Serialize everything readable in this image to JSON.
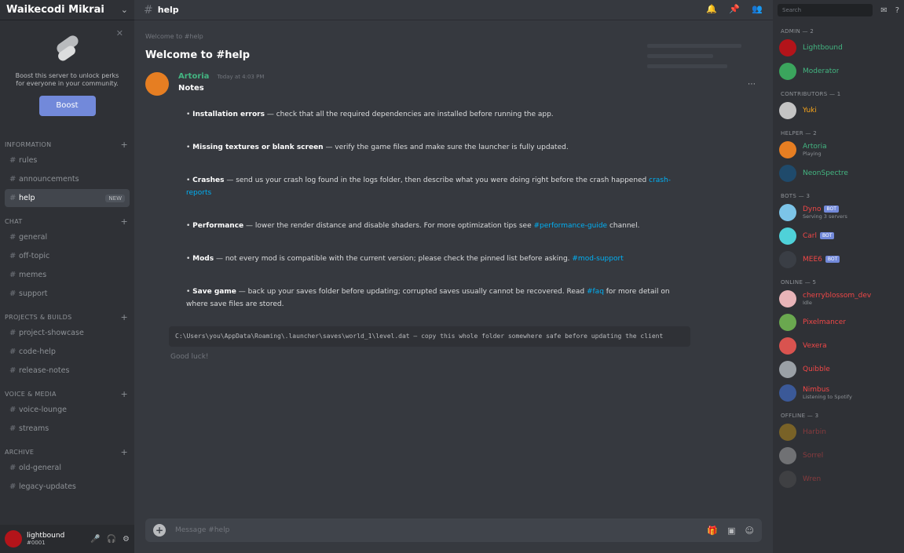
{
  "sidebar": {
    "server_name": "Waikecodi Mikrai",
    "boost": {
      "text": "Boost this server to unlock perks for everyone in your community.",
      "button": "Boost"
    },
    "categories": [
      {
        "label": "Information",
        "channels": [
          "rules",
          "announcements"
        ]
      },
      {
        "label": "Chat",
        "channels": [
          "general",
          "off-topic",
          "memes",
          "support"
        ]
      },
      {
        "label": "Projects & Builds",
        "channels": [
          "project-showcase",
          "code-help",
          "release-notes"
        ]
      },
      {
        "label": "Voice & Media",
        "channels": [
          "voice-lounge",
          "streams"
        ]
      },
      {
        "label": "Archive",
        "channels": [
          "old-general",
          "legacy-updates"
        ]
      }
    ],
    "active_channel": "help",
    "active_badge": "NEW",
    "user": {
      "name": "lightbound",
      "tag": "#0001"
    }
  },
  "main": {
    "channel_name": "help",
    "welcome_small": "Welcome to #help",
    "welcome_title": "Welcome to #help",
    "message": {
      "author": "Artoria",
      "time": "Today at 4:03 PM",
      "heading": "Notes",
      "items": [
        {
          "key": "Installation errors",
          "text": " — check that all the required dependencies are installed before running the app."
        },
        {
          "key": "Missing textures or blank screen",
          "text": " — verify the game files and make sure the launcher is fully updated."
        },
        {
          "key": "Crashes",
          "text": " — send us your crash log found in the logs folder, then describe what you were doing right before the crash happened ",
          "link": "crash-reports"
        },
        {
          "key": "Performance",
          "text": " — lower the render distance and disable shaders. For more optimization tips see ",
          "link": "#performance-guide",
          "tail": " channel."
        },
        {
          "key": "Mods",
          "text": " — not every mod is compatible with the current version; please check the pinned list before asking. ",
          "link": "#mod-support"
        },
        {
          "key": "Save game",
          "text": " — back up your saves folder before updating; corrupted saves usually cannot be recovered. Read ",
          "link": "#faq",
          "tail": " for more detail on where save files are stored."
        }
      ],
      "code": "C:\\Users\\you\\AppData\\Roaming\\.launcher\\saves\\world_1\\level.dat — copy this whole folder somewhere safe before updating the client",
      "after_code": "Good luck!"
    },
    "composer_placeholder": "Message #help"
  },
  "members": {
    "search": "Search",
    "groups": [
      {
        "role": "Admin — 2",
        "people": [
          {
            "name": "Lightbound",
            "color": "#43b581",
            "av": "#b3141a"
          },
          {
            "name": "Moderator",
            "color": "#43b581",
            "av": "#3ba55d"
          }
        ]
      },
      {
        "role": "Contributors — 1",
        "people": [
          {
            "name": "Yuki",
            "color": "#faa61a",
            "av": "#c4c4c4"
          }
        ]
      },
      {
        "role": "Helper — 2",
        "people": [
          {
            "name": "Artoria",
            "sub": "Playing",
            "color": "#43b581",
            "av": "#e67e22"
          },
          {
            "name": "NeonSpectre",
            "color": "#43b581",
            "av": "#1f4a6b"
          }
        ]
      },
      {
        "role": "Bots — 3",
        "people": [
          {
            "name": "Dyno",
            "sub": "Serving 3 servers",
            "bot": "BOT",
            "color": "#f04747",
            "av": "#7cc4e8"
          },
          {
            "name": "Carl",
            "bot": "BOT",
            "color": "#f04747",
            "av": "#4fd1d9"
          },
          {
            "name": "MEE6",
            "bot": "BOT",
            "color": "#f04747",
            "av": "#3a3e45"
          }
        ]
      },
      {
        "role": "Online — 5",
        "people": [
          {
            "name": "cherryblossom_dev",
            "sub": "Idle",
            "color": "#f04747",
            "av": "#e8b4b8"
          },
          {
            "name": "Pixelmancer",
            "color": "#f04747",
            "av": "#6aa84f"
          },
          {
            "name": "Vexera",
            "color": "#f04747",
            "av": "#d9534f"
          },
          {
            "name": "Quibble",
            "color": "#f04747",
            "av": "#9aa0a6"
          },
          {
            "name": "Nimbus",
            "sub": "Listening to Spotify",
            "color": "#f04747",
            "av": "#3b5998"
          }
        ]
      },
      {
        "role": "Offline — 3",
        "dim": true,
        "people": [
          {
            "name": "Harbin",
            "color": "#f04747",
            "av": "#d4a017"
          },
          {
            "name": "Sorrel",
            "color": "#f04747",
            "av": "#c0c0c0"
          },
          {
            "name": "Wren",
            "color": "#f04747",
            "av": "#555"
          }
        ]
      }
    ]
  }
}
